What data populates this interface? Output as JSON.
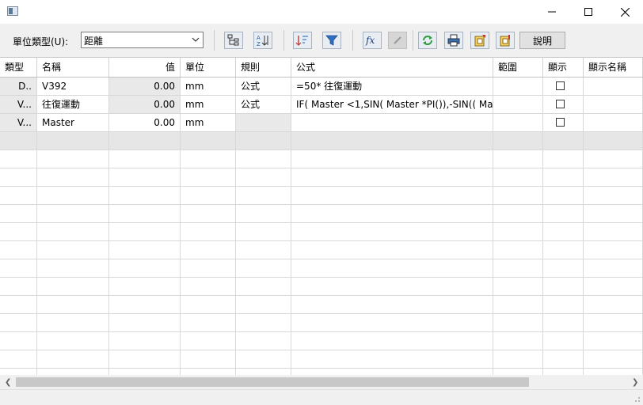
{
  "window": {
    "icon": "app-window-icon",
    "controls": {
      "minimize": "minimize-icon",
      "maximize": "maximize-icon",
      "close": "close-icon"
    }
  },
  "toolbar": {
    "unit_type_label": "單位類型(U):",
    "unit_type_value": "距離",
    "help_label": "說明",
    "buttons": [
      {
        "name": "tree-view-button",
        "icon": "tree-icon"
      },
      {
        "name": "sort-az-button",
        "icon": "sort-az-icon"
      },
      {
        "name": "sort-order-button",
        "icon": "sort-order-icon"
      },
      {
        "name": "filter-button",
        "icon": "filter-icon"
      },
      {
        "name": "formula-button",
        "icon": "fx-icon"
      },
      {
        "name": "edit-button",
        "icon": "pencil-icon",
        "disabled": true
      },
      {
        "name": "refresh-button",
        "icon": "refresh-icon"
      },
      {
        "name": "print-button",
        "icon": "print-icon"
      },
      {
        "name": "export-button",
        "icon": "export-icon"
      },
      {
        "name": "import-button",
        "icon": "import-icon"
      }
    ]
  },
  "table": {
    "columns": [
      "類型",
      "名稱",
      "值",
      "單位",
      "規則",
      "公式",
      "範圍",
      "顯示",
      "顯示名稱"
    ],
    "rows": [
      {
        "type": "D..",
        "name": "V392",
        "value": "0.00",
        "unit": "mm",
        "rule": "公式",
        "formula": "=50* 往復運動",
        "range": "",
        "show": false,
        "display_name": ""
      },
      {
        "type": "V...",
        "name": "往復運動",
        "value": "0.00",
        "unit": "mm",
        "rule": "公式",
        "formula": "IF( Master <1,SIN( Master *PI()),-SIN(( Ma...",
        "range": "",
        "show": false,
        "display_name": ""
      },
      {
        "type": "V...",
        "name": "Master",
        "value": "0.00",
        "unit": "mm",
        "rule": "",
        "formula": "",
        "range": "",
        "show": false,
        "display_name": ""
      }
    ]
  },
  "colors": {
    "accent_blue": "#1e5fa8",
    "grid_line": "#d8d8d8",
    "readonly_cell": "#e9e9e9"
  }
}
